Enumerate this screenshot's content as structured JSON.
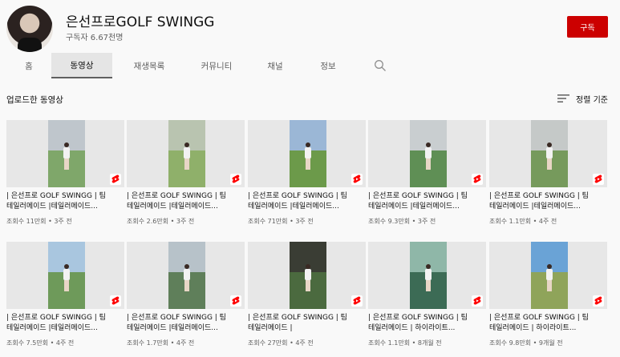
{
  "channel": {
    "name": "은선프로GOLF SWINGG",
    "subscribers": "구독자 6.67천명",
    "subscribe_label": "구독"
  },
  "tabs": [
    {
      "label": "홈"
    },
    {
      "label": "동영상"
    },
    {
      "label": "재생목록"
    },
    {
      "label": "커뮤니티"
    },
    {
      "label": "채널"
    },
    {
      "label": "정보"
    }
  ],
  "section": {
    "title": "업로드한 동영상",
    "sort_label": "정렬 기준"
  },
  "icons": {
    "search": "search-icon",
    "sort": "sort-icon",
    "shorts": "shorts-icon"
  },
  "colors": {
    "accent": "#cc0000"
  },
  "videos": [
    {
      "title_line1": "| 은선프로 GOLF SWINGG | 팀",
      "title_line2": "테일러메이드 |테일러메이드...",
      "views": "조회수 11만회",
      "age": "3주 전"
    },
    {
      "title_line1": "| 은선프로 GOLF SWINGG | 팀",
      "title_line2": "테일러메이드 |테일러메이드...",
      "views": "조회수 2.6만회",
      "age": "3주 전"
    },
    {
      "title_line1": "| 은선프로 GOLF SWINGG | 팀",
      "title_line2": "테일러메이드 |테일러메이드...",
      "views": "조회수 71만회",
      "age": "3주 전"
    },
    {
      "title_line1": "| 은선프로 GOLF SWINGG | 팀",
      "title_line2": "테일러메이드 |테일러메이드...",
      "views": "조회수 9.3만회",
      "age": "3주 전"
    },
    {
      "title_line1": "| 은선프로 GOLF SWINGG | 팀",
      "title_line2": "테일러메이드 |테일러메이드...",
      "views": "조회수 1.1만회",
      "age": "4주 전"
    },
    {
      "title_line1": "| 은선프로 GOLF SWINGG | 팀",
      "title_line2": "테일러메이드 |테일러메이드...",
      "views": "조회수 7.5만회",
      "age": "4주 전"
    },
    {
      "title_line1": "| 은선프로 GOLF SWINGG | 팀",
      "title_line2": "테일러메이드 |테일러메이드...",
      "views": "조회수 1.7만회",
      "age": "4주 전"
    },
    {
      "title_line1": "| 은선프로 GOLF SWINGG | 팀",
      "title_line2": "테일러메이드 |",
      "views": "조회수 27만회",
      "age": "4주 전"
    },
    {
      "title_line1": "| 은선프로 GOLF SWINGG | 팀",
      "title_line2": "테일러메이드 | 하이라이트...",
      "views": "조회수 1.1만회",
      "age": "8개월 전"
    },
    {
      "title_line1": "| 은선프로 GOLF SWINGG | 팀",
      "title_line2": "테일러메이드 | 하이라이트...",
      "views": "조회수 9.8만회",
      "age": "9개월 전"
    }
  ]
}
